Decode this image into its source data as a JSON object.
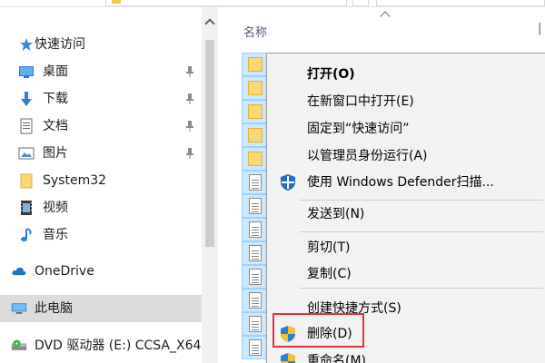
{
  "header": {
    "column_name": "名称",
    "column_edge": "|"
  },
  "nav": {
    "items": [
      {
        "label": "快速访问",
        "icon": "star-icon",
        "pinned": false,
        "selected": false
      },
      {
        "label": "桌面",
        "icon": "desktop-icon",
        "pinned": true,
        "selected": false
      },
      {
        "label": "下载",
        "icon": "download-arrow-icon",
        "pinned": true,
        "selected": false
      },
      {
        "label": "文档",
        "icon": "document-icon",
        "pinned": true,
        "selected": false
      },
      {
        "label": "图片",
        "icon": "picture-icon",
        "pinned": true,
        "selected": false
      },
      {
        "label": "System32",
        "icon": "folder-icon",
        "pinned": false,
        "selected": false
      },
      {
        "label": "视频",
        "icon": "video-icon",
        "pinned": false,
        "selected": false
      },
      {
        "label": "音乐",
        "icon": "music-note-icon",
        "pinned": false,
        "selected": false
      },
      {
        "label": "OneDrive",
        "icon": "cloud-icon",
        "pinned": false,
        "selected": false
      },
      {
        "label": "此电脑",
        "icon": "computer-icon",
        "pinned": false,
        "selected": true
      },
      {
        "label": "DVD 驱动器 (E:) CCSA_X64",
        "icon": "dvd-drive-icon",
        "pinned": false,
        "selected": false
      }
    ]
  },
  "context_menu": {
    "items": [
      {
        "label": "打开(O)",
        "bold": true
      },
      {
        "label": "在新窗口中打开(E)"
      },
      {
        "label": "固定到“快速访问”"
      },
      {
        "label": "以管理员身份运行(A)"
      },
      {
        "label": "使用 Windows Defender扫描...",
        "icon": "windows-defender-icon"
      },
      {
        "label": "发送到(N)"
      },
      {
        "label": "剪切(T)"
      },
      {
        "label": "复制(C)"
      },
      {
        "label": "创建快捷方式(S)"
      },
      {
        "label": "删除(D)",
        "icon": "uac-shield-icon",
        "highlighted": true
      },
      {
        "label": "重命名(M)",
        "icon": "uac-shield-icon"
      }
    ]
  },
  "colors": {
    "highlight_box": "#e0323a",
    "selection": "#cce8ff",
    "folder": "#f8d775"
  }
}
